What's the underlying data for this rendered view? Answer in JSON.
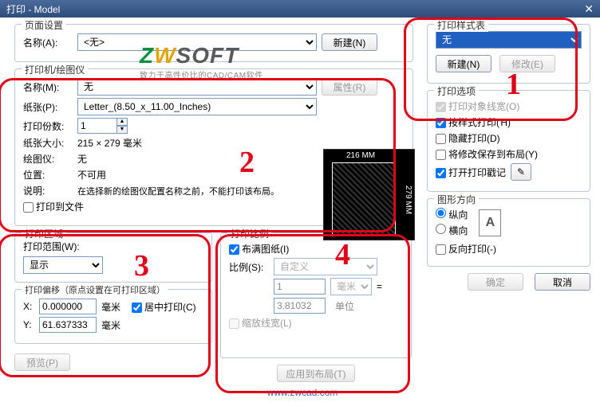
{
  "window": {
    "title": "打印 - Model"
  },
  "page_setup": {
    "legend": "页面设置",
    "name_label": "名称(A):",
    "name_value": "<无>",
    "new_btn": "新建(N)"
  },
  "logo": {
    "slogan": "致力于高性价比的CAD/CAM软件"
  },
  "printer": {
    "legend": "打印机/绘图仪",
    "name_label": "名称(M):",
    "name_value": "无",
    "props_btn": "属性(R)",
    "paper_label": "纸张(P):",
    "paper_value": "Letter_(8.50_x_11.00_Inches)",
    "copies_label": "打印份数:",
    "copies_value": "1",
    "size_label": "纸张大小:",
    "size_value": "215 × 279  毫米",
    "plotter_label": "绘图仪:",
    "plotter_value": "无",
    "location_label": "位置:",
    "location_value": "不可用",
    "desc_label": "说明:",
    "desc_value": "在选择新的绘图仪配置名称之前，不能打印该布局。",
    "to_file": "打印到文件",
    "preview_w": "216 MM",
    "preview_h": "279 MM"
  },
  "area": {
    "legend": "打印区域",
    "range_label": "打印范围(W):",
    "range_value": "显示"
  },
  "offset": {
    "legend": "打印偏移（原点设置在可打印区域）",
    "x_label": "X:",
    "x_value": "0.000000",
    "unit": "毫米",
    "y_label": "Y:",
    "y_value": "61.637333",
    "center": "居中打印(C)",
    "preview_btn": "预览(P)"
  },
  "scale": {
    "legend": "打印比例",
    "fit": "布满图纸(I)",
    "ratio_label": "比例(S):",
    "ratio_value": "自定义",
    "num": "1",
    "unit_sel": "毫米",
    "eq": "=",
    "den": "3.81032",
    "den_unit": "单位",
    "scale_lw": "缩放线宽(L)",
    "apply_btn": "应用到布局(T)"
  },
  "style": {
    "legend": "打印样式表",
    "value": "无",
    "new_btn": "新建(N)",
    "edit_btn": "修改(E)"
  },
  "options": {
    "legend": "打印选项",
    "o1": "打印对象线宽(O)",
    "o2": "按样式打印(Ή)",
    "o3": "隐藏打印(D)",
    "o4": "将修改保存到布局(Y)",
    "o5": "打开打印戳记"
  },
  "orient": {
    "legend": "图形方向",
    "portrait": "纵向",
    "landscape": "横向",
    "reverse": "反向打印(-)"
  },
  "buttons": {
    "ok": "确定",
    "cancel": "取消"
  },
  "footer": "www.zwcad.com"
}
